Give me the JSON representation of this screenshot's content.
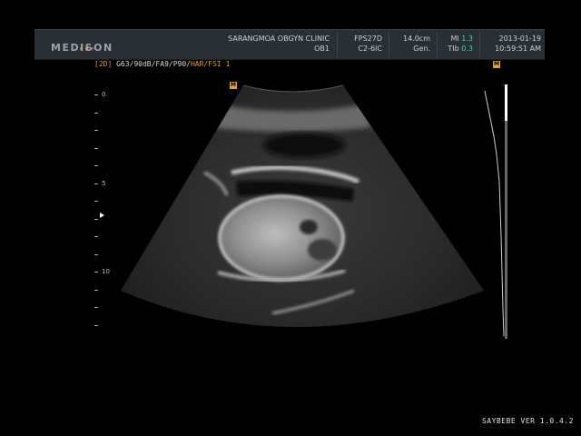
{
  "header": {
    "brand": "MEDISON",
    "dot_colors": [
      "#e7702a",
      "#e8b23b",
      "#d0502d"
    ],
    "clinic": "SARANGMOA OBGYN CLINIC",
    "preset": "OB1",
    "fps": "FPS27D",
    "probe": "C2-6IC",
    "depth": "14.0cm",
    "mode": "Gen.",
    "mi_label": "MI",
    "mi_value": "1.3",
    "tib_label": "TIb",
    "tib_value": "0.3",
    "date": "2013-01-19",
    "time": "10:59:51 AM"
  },
  "params": {
    "mode_tag": "[2D]",
    "settings_white": " G63/90dB/FA9/P90/",
    "settings_orange": "HAR/FSI 1"
  },
  "markers": {
    "probe_orientation": "M",
    "right_marker": "M"
  },
  "depth_scale": {
    "labels": [
      "0",
      "5",
      "10"
    ]
  },
  "footer": {
    "version": "SAYBEBE VER 1.0.4.2"
  }
}
